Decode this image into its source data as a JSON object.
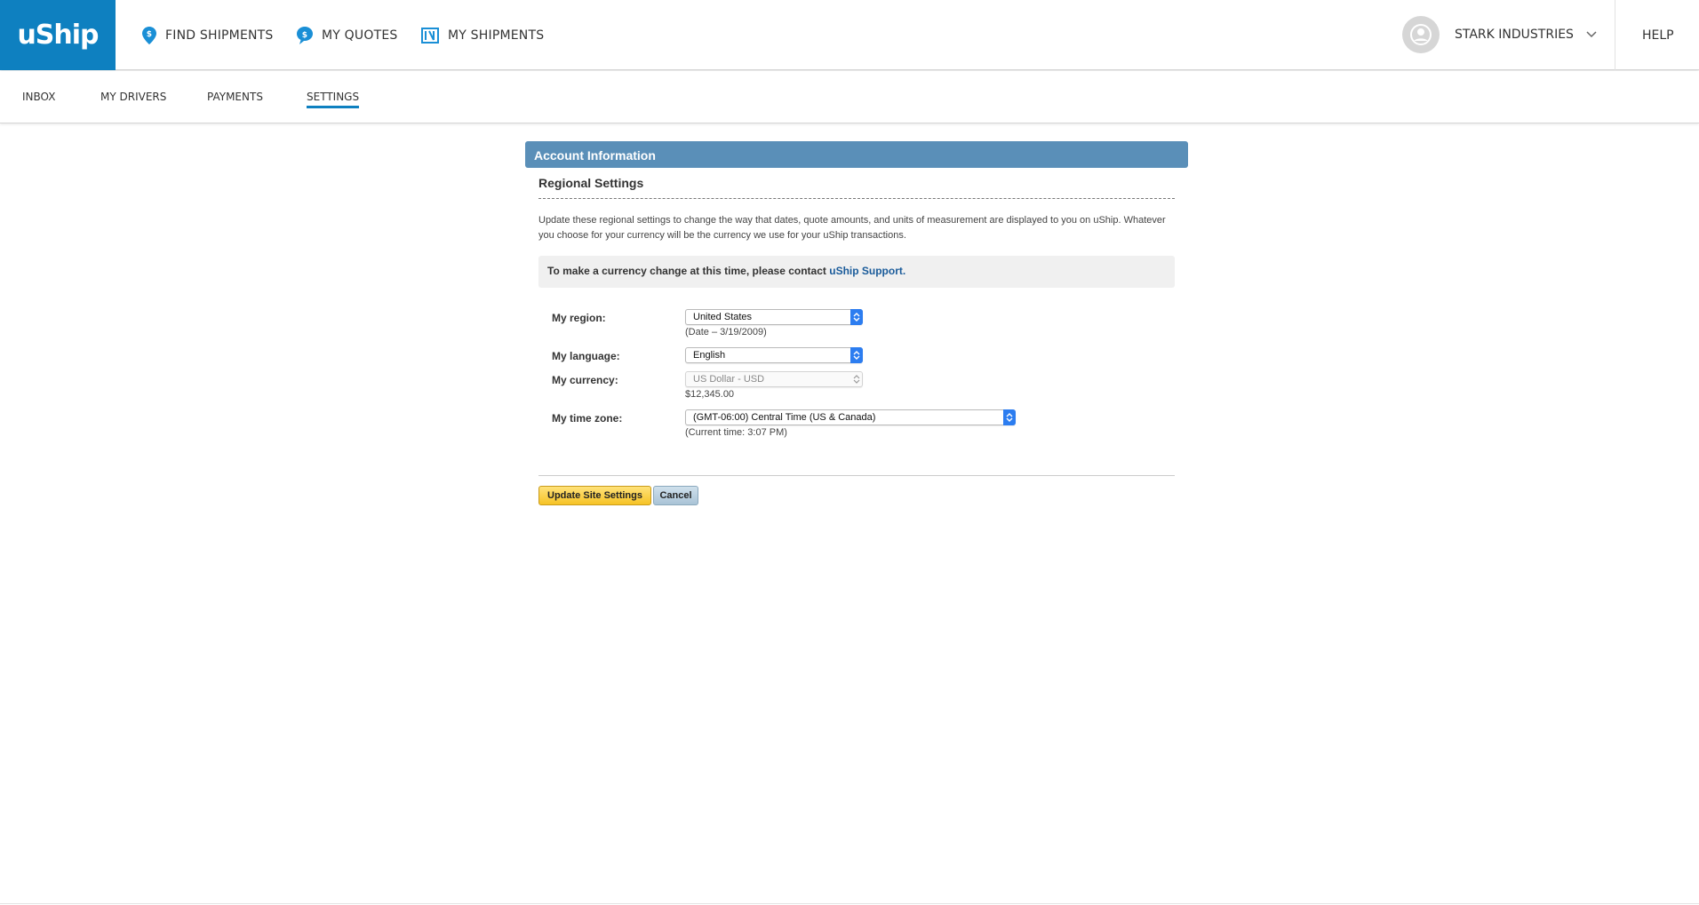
{
  "brand": {
    "logo_text": "uShip",
    "accent": "#0e80c0"
  },
  "topnav": {
    "find_shipments": "FIND SHIPMENTS",
    "my_quotes": "MY QUOTES",
    "my_shipments": "MY SHIPMENTS"
  },
  "account": {
    "name": "STARK INDUSTRIES"
  },
  "help": "HELP",
  "subnav": {
    "inbox": "INBOX",
    "my_drivers": "MY DRIVERS",
    "payments": "PAYMENTS",
    "settings": "SETTINGS"
  },
  "panel": {
    "title": "Account Information",
    "section_title": "Regional Settings",
    "description": "Update these regional settings to change the way that dates, quote amounts, and units of measurement are displayed to you on uShip. Whatever you choose for your currency will be the currency we use for your uShip transactions.",
    "notice_text": "To make a currency change at this time, please contact ",
    "notice_link": "uShip Support."
  },
  "form": {
    "region": {
      "label": "My region:",
      "value": "United States",
      "hint": "(Date – 3/19/2009)"
    },
    "language": {
      "label": "My language:",
      "value": "English"
    },
    "currency": {
      "label": "My currency:",
      "value": "US Dollar - USD",
      "hint": "$12,345.00"
    },
    "timezone": {
      "label": "My time zone:",
      "value": "(GMT-06:00) Central Time (US & Canada)",
      "hint": "(Current time: 3:07 PM)"
    }
  },
  "buttons": {
    "update": "Update Site Settings",
    "cancel": "Cancel"
  }
}
